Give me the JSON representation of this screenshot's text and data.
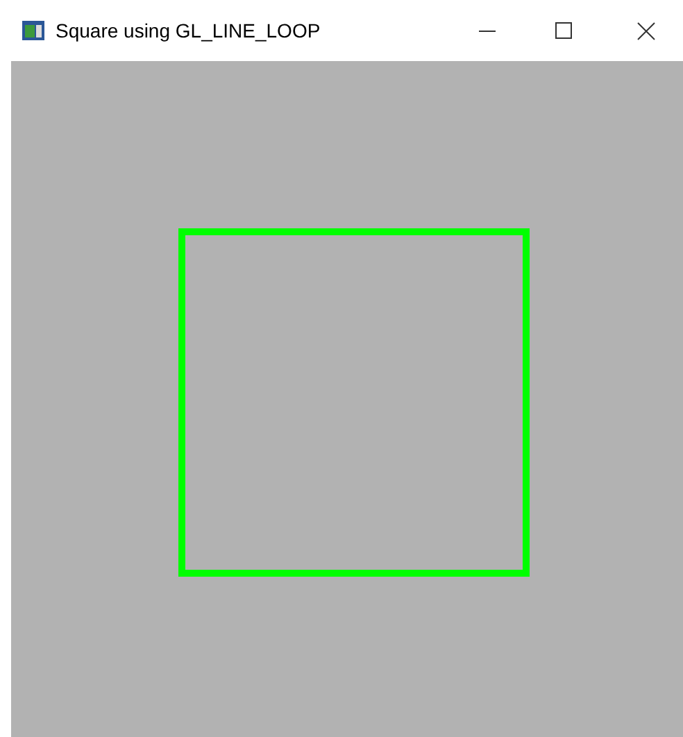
{
  "window": {
    "title": "Square using GL_LINE_LOOP"
  }
}
